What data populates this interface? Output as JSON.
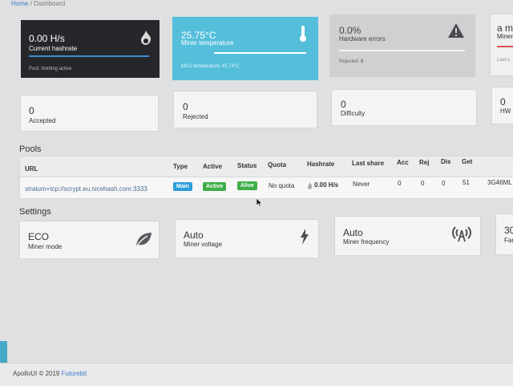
{
  "breadcrumb": {
    "home": "Home",
    "sep": "/",
    "current": "Dashboard"
  },
  "stats": [
    {
      "value": "0.00 H/s",
      "label": "Current hashrate",
      "foot": "Pool: Nothing active",
      "icon": "flame-icon"
    },
    {
      "value": "25.75°C",
      "label": "Miner temperature",
      "foot": "MCU temperature: 41.74°C",
      "icon": "thermometer-icon"
    },
    {
      "value": "0.0%",
      "label": "Hardware errors",
      "foot_label": "Rejected:",
      "foot_value": "0",
      "icon": "warning-icon"
    },
    {
      "value": "a m",
      "label": "Miner",
      "foot": "Last s"
    }
  ],
  "counters": [
    {
      "value": "0",
      "label": "Accepted"
    },
    {
      "value": "0",
      "label": "Rejected"
    },
    {
      "value": "0",
      "label": "Difficulty"
    },
    {
      "value": "0",
      "label": "HW"
    }
  ],
  "pools": {
    "title": "Pools",
    "headers": {
      "url": "URL",
      "type": "Type",
      "active": "Active",
      "status": "Status",
      "quota": "Quota",
      "hashrate": "Hashrate",
      "last_share": "Last share",
      "acc": "Acc",
      "rej": "Rej",
      "dis": "Dis",
      "get": "Get"
    },
    "row": {
      "url": "stratum+tcp://scrypt.eu.nicehash.com:3333",
      "type": "Main",
      "active": "Active",
      "status": "Alive",
      "quota": "No quota",
      "hashrate": "0.00 H/s",
      "last_share": "Never",
      "acc": "0",
      "rej": "0",
      "dis": "0",
      "get": "51",
      "extra": "3G46ML"
    }
  },
  "settings": {
    "title": "Settings",
    "items": [
      {
        "value": "ECO",
        "label": "Miner mode",
        "icon": "leaf-icon"
      },
      {
        "value": "Auto",
        "label": "Miner voltage",
        "icon": "bolt-icon"
      },
      {
        "value": "Auto",
        "label": "Miner frequency",
        "icon": "antenna-icon"
      },
      {
        "value": "30",
        "label": "Fan"
      }
    ]
  },
  "footer": {
    "text": "ApolloUI © 2019",
    "brand": "Futurebit"
  },
  "colors": {
    "dark": "#25272b",
    "cyan": "#55bfdb",
    "grey": "#cfd0d2",
    "blue_badge": "#2d9fd9",
    "green_badge": "#3fae49",
    "red": "#d9534f"
  }
}
